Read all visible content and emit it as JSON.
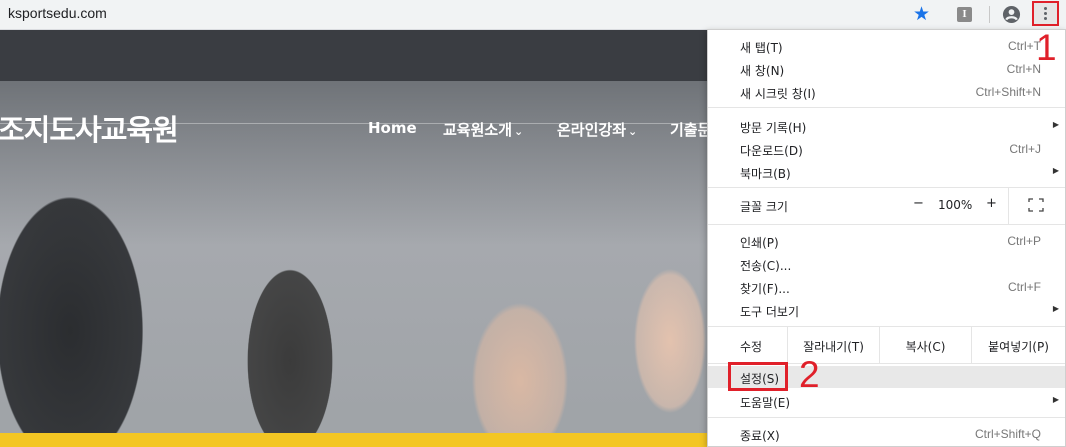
{
  "browser": {
    "url": "ksportsedu.com",
    "icons": [
      "star-icon",
      "extension-icon",
      "account-icon",
      "more-vert-icon"
    ],
    "accent": "#1a73e8"
  },
  "site": {
    "brand": "조지도사교육원",
    "nav": [
      {
        "label": "Home",
        "dropdown": false
      },
      {
        "label": "교육원소개",
        "dropdown": true
      },
      {
        "label": "온라인강좌",
        "dropdown": true
      },
      {
        "label": "기출문",
        "dropdown": false
      }
    ],
    "band_color": "#f3c623"
  },
  "menu": {
    "new_tab": {
      "label": "새 탭(T)",
      "shortcut": "Ctrl+T"
    },
    "new_window": {
      "label": "새 창(N)",
      "shortcut": "Ctrl+N"
    },
    "new_incognito": {
      "label": "새 시크릿 창(I)",
      "shortcut": "Ctrl+Shift+N"
    },
    "history": {
      "label": "방문 기록(H)"
    },
    "downloads": {
      "label": "다운로드(D)",
      "shortcut": "Ctrl+J"
    },
    "bookmarks": {
      "label": "북마크(B)"
    },
    "zoom": {
      "label": "글꼴 크기",
      "minus": "−",
      "value": "100%",
      "plus": "+"
    },
    "print": {
      "label": "인쇄(P)",
      "shortcut": "Ctrl+P"
    },
    "cast": {
      "label": "전송(C)..."
    },
    "find": {
      "label": "찾기(F)...",
      "shortcut": "Ctrl+F"
    },
    "more_tools": {
      "label": "도구 더보기"
    },
    "edit": {
      "label": "수정",
      "cut": "잘라내기(T)",
      "copy": "복사(C)",
      "paste": "붙여넣기(P)"
    },
    "settings": {
      "label": "설정(S)"
    },
    "help": {
      "label": "도움말(E)"
    },
    "exit": {
      "label": "종료(X)",
      "shortcut": "Ctrl+Shift+Q"
    }
  },
  "annotations": {
    "step1": "1",
    "step2": "2",
    "color": "#e0202a"
  }
}
